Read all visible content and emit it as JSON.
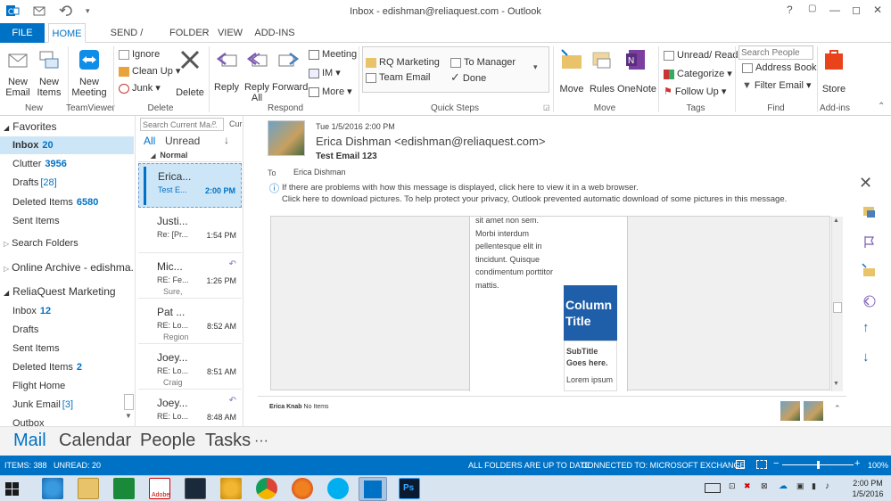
{
  "window": {
    "title": "Inbox - edishman@reliaquest.com - Outlook",
    "controls": {
      "help": "?",
      "restore": "▢",
      "minimize": "—",
      "maximize": "◻",
      "close": "✕"
    }
  },
  "qat": {
    "icons": [
      "outlook-icon",
      "send-receive-icon",
      "undo-icon"
    ]
  },
  "tabs": [
    {
      "label": "FILE"
    },
    {
      "label": "HOME"
    },
    {
      "label": "SEND / RECEIVE"
    },
    {
      "label": "FOLDER"
    },
    {
      "label": "VIEW"
    },
    {
      "label": "ADD-INS"
    }
  ],
  "ribbon": {
    "new_email": "New\nEmail",
    "new_items": "New\nItems",
    "group_new": "New",
    "new_meeting": "New\nMeeting",
    "group_teamviewer": "TeamViewer",
    "ignore": "Ignore",
    "clean_up": "Clean Up",
    "junk": "Junk",
    "delete": "Delete",
    "group_delete": "Delete",
    "reply": "Reply",
    "reply_all": "Reply\nAll",
    "forward": "Forward",
    "meeting": "Meeting",
    "im": "IM",
    "more": "More",
    "group_respond": "Respond",
    "qs_rq_marketing": "RQ Marketing",
    "qs_team_email": "Team Email",
    "qs_to_manager": "To Manager",
    "qs_done": "Done",
    "group_quicksteps": "Quick Steps",
    "move": "Move",
    "rules": "Rules",
    "onenote": "OneNote",
    "group_move": "Move",
    "unread_read": "Unread/ Read",
    "categorize": "Categorize",
    "follow_up": "Follow Up",
    "group_tags": "Tags",
    "search_people_placeholder": "Search People",
    "address_book": "Address Book",
    "filter_email": "Filter Email",
    "group_find": "Find",
    "store": "Store",
    "group_addins": "Add-ins"
  },
  "nav": {
    "favorites": "Favorites",
    "items": [
      {
        "label": "Inbox",
        "count": "20"
      },
      {
        "label": "Clutter",
        "count": "3956"
      },
      {
        "label": "Drafts",
        "count": "[28]"
      },
      {
        "label": "Deleted Items",
        "count": "6580"
      },
      {
        "label": "Sent Items",
        "count": ""
      }
    ],
    "search_folders": "Search Folders",
    "online_archive": "Online Archive - edishma...",
    "reliaquest": "ReliaQuest Marketing",
    "rq_items": [
      {
        "label": "Inbox",
        "count": "12"
      },
      {
        "label": "Drafts",
        "count": ""
      },
      {
        "label": "Sent Items",
        "count": ""
      },
      {
        "label": "Deleted Items",
        "count": "2"
      },
      {
        "label": "Flight Home",
        "count": ""
      },
      {
        "label": "Junk Email",
        "count": "[3]"
      },
      {
        "label": "Outbox",
        "count": ""
      }
    ]
  },
  "maillist": {
    "search_placeholder": "Search Current Ma...",
    "scope": "Current",
    "filter_all": "All",
    "filter_unread": "Unread",
    "sort_arrow": "↓",
    "group_header": "Normal",
    "items": [
      {
        "from": "Erica...",
        "subject": "Test E...",
        "time": "2:00 PM",
        "preview": ""
      },
      {
        "from": "Justi...",
        "subject": "Re: [Pr...",
        "time": "1:54 PM",
        "preview": ""
      },
      {
        "from": "Mic...",
        "subject": "RE: Fe...",
        "time": "1:26 PM",
        "preview": "Sure,"
      },
      {
        "from": "Pat ...",
        "subject": "RE: Lo...",
        "time": "8:52 AM",
        "preview": "Region"
      },
      {
        "from": "Joey...",
        "subject": "RE: Lo...",
        "time": "8:51 AM",
        "preview": "Craig"
      },
      {
        "from": "Joey...",
        "subject": "RE: Lo...",
        "time": "8:48 AM",
        "preview": "..."
      }
    ]
  },
  "message": {
    "date": "Tue 1/5/2016 2:00 PM",
    "sender": "Erica Dishman <edishman@reliaquest.com>",
    "subject": "Test Email 123",
    "to_label": "To",
    "to": "Erica Dishman",
    "info_line1": "If there are problems with how this message is displayed, click here to view it in a web browser.",
    "info_line2": "Click here to download pictures. To help protect your privacy, Outlook prevented automatic download of some pictures in this message.",
    "body_text": "sit amet non sem. Morbi interdum pellentesque elit in tincidunt. Quisque condimentum porttitor mattis.",
    "column_title": "Column Title",
    "subtitle": "SubTitle Goes here.",
    "lorem": "Lorem ipsum",
    "people_name": "Erica Knab",
    "people_status": "No Items"
  },
  "bottom_nav": {
    "mail": "Mail",
    "calendar": "Calendar",
    "people": "People",
    "tasks": "Tasks",
    "more": "···"
  },
  "status": {
    "items": "ITEMS: 388",
    "unread": "UNREAD: 20",
    "folders": "ALL FOLDERS ARE UP TO DATE.",
    "connected": "CONNECTED TO: MICROSOFT EXCHANGE",
    "zoom": "100%",
    "zoom_level": 0.5
  },
  "taskbar": {
    "time": "2:00 PM",
    "date": "1/5/2016"
  },
  "colors": {
    "accent": "#0072c6",
    "selected": "#cde6f7",
    "column_title_bg": "#1f5ea8"
  }
}
